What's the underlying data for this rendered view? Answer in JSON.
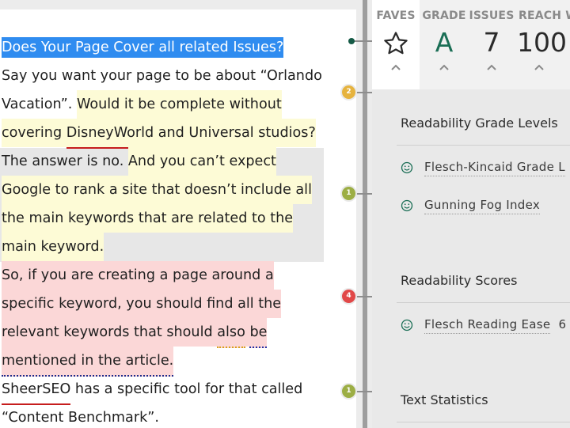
{
  "editor": {
    "lines": [
      {
        "segments": [
          {
            "text": "Does Your Page Cover all related Issues?",
            "style": "sel"
          }
        ]
      },
      {
        "segments": [
          {
            "text": "Say you want your page to be about “Orlando",
            "style": ""
          }
        ]
      },
      {
        "segments": [
          {
            "text": "Vacation”. ",
            "style": ""
          },
          {
            "text": "Would it be complete without",
            "style": "y"
          }
        ]
      },
      {
        "segments": [
          {
            "text": "covering ",
            "style": "y"
          },
          {
            "text": "DisneyWorld",
            "style": "y ul-red"
          },
          {
            "text": " and Universal studios?",
            "style": "y"
          }
        ]
      },
      {
        "segments": [
          {
            "text": "The answer is no. ",
            "style": ""
          },
          {
            "text": "And you can’t expect",
            "style": "y"
          }
        ]
      },
      {
        "segments": [
          {
            "text": "Google to rank a site that doesn’t include all",
            "style": "y"
          }
        ]
      },
      {
        "segments": [
          {
            "text": "the main keywords that are related to the",
            "style": "y"
          }
        ]
      },
      {
        "segments": [
          {
            "text": "main keyword.",
            "style": "y"
          }
        ]
      },
      {
        "segments": [
          {
            "text": "So, if you are creating a page around a",
            "style": "r"
          }
        ]
      },
      {
        "segments": [
          {
            "text": "specific keyword, you should find all the",
            "style": "r"
          }
        ]
      },
      {
        "segments": [
          {
            "text": "relevant keywords that should ",
            "style": "r"
          },
          {
            "text": "also",
            "style": "r ul-orange-dot"
          },
          {
            "text": " ",
            "style": "r"
          },
          {
            "text": "be",
            "style": "r ul-blue-dot"
          }
        ]
      },
      {
        "segments": [
          {
            "text": "mentioned in the article.",
            "style": "r ul-navy-dot"
          }
        ]
      },
      {
        "segments": [
          {
            "text": "SheerSEO",
            "style": "ul-red"
          },
          {
            "text": " has a specific tool for that called",
            "style": ""
          }
        ]
      },
      {
        "segments": [
          {
            "text": "“Content Benchmark”.",
            "style": ""
          }
        ]
      }
    ],
    "markers": [
      {
        "label": "2",
        "color": "#e6b33e"
      },
      {
        "label": "1",
        "color": "#9cae44"
      },
      {
        "label": "4",
        "color": "#e14848"
      },
      {
        "label": "1",
        "color": "#9cae44"
      }
    ]
  },
  "panel": {
    "stats": [
      {
        "label": "FAVES",
        "value": "",
        "icon": "star-icon"
      },
      {
        "label": "GRADE",
        "value": "A",
        "color": "#1a6e55"
      },
      {
        "label": "ISSUES",
        "value": "7"
      },
      {
        "label": "REACH W",
        "value": "100"
      }
    ],
    "sections": [
      {
        "title": "Readability Grade Levels",
        "metrics": [
          {
            "label": "Flesch-Kincaid Grade L",
            "value": ""
          },
          {
            "label": "Gunning Fog Index",
            "value": ""
          }
        ]
      },
      {
        "title": "Readability Scores",
        "metrics": [
          {
            "label": "Flesch Reading Ease",
            "value": "6"
          }
        ]
      },
      {
        "title": "Text Statistics",
        "metrics": []
      }
    ]
  },
  "colors": {
    "selection": "#2f8cf0",
    "highlight_yellow": "#fdfbd6",
    "highlight_red": "#fbd7d7",
    "grade_green": "#1a6e55",
    "smile_green": "#1a6e55"
  }
}
